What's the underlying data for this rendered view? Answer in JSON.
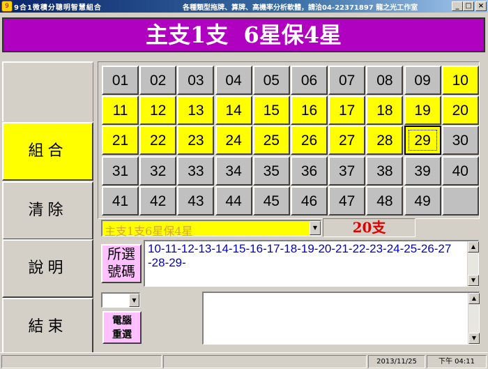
{
  "window": {
    "title_left": "9合1微積分聰明智慧組合",
    "title_right": "各種類型拖牌、算牌、高機率分析軟體，請洽04-22371897 龍之光工作室",
    "controls": {
      "minimize": "_",
      "maximize": "□",
      "close": "×"
    }
  },
  "banner": {
    "text": "主支1支  6星保4星"
  },
  "sidebar": {
    "combine": "組合",
    "clear": "清除",
    "help": "說明",
    "exit": "結束"
  },
  "grid": {
    "numbers": [
      "01",
      "02",
      "03",
      "04",
      "05",
      "06",
      "07",
      "08",
      "09",
      "10",
      "11",
      "12",
      "13",
      "14",
      "15",
      "16",
      "17",
      "18",
      "19",
      "20",
      "21",
      "22",
      "23",
      "24",
      "25",
      "26",
      "27",
      "28",
      "29",
      "30",
      "31",
      "32",
      "33",
      "34",
      "35",
      "36",
      "37",
      "38",
      "39",
      "40",
      "41",
      "42",
      "43",
      "44",
      "45",
      "46",
      "47",
      "48",
      "49"
    ],
    "selected": [
      "10",
      "11",
      "12",
      "13",
      "14",
      "15",
      "16",
      "17",
      "18",
      "19",
      "20",
      "21",
      "22",
      "23",
      "24",
      "25",
      "26",
      "27",
      "28",
      "29"
    ],
    "focused": "29",
    "colors": {
      "on": "#ffff00",
      "off": "#c0c0c0"
    }
  },
  "mode_select": {
    "value": "主支1支6星保4星"
  },
  "count_display": {
    "value": "20支"
  },
  "selection": {
    "label": "所選號碼",
    "numbers_text": "10-11-12-13-14-15-16-17-18-19-20-21-22-23-24-25-26-27-28-29-"
  },
  "random_button": {
    "label": "電腦重選"
  },
  "statusbar": {
    "panel1": "",
    "panel2": "",
    "date": "2013/11/25",
    "time": "下午 04:11"
  }
}
